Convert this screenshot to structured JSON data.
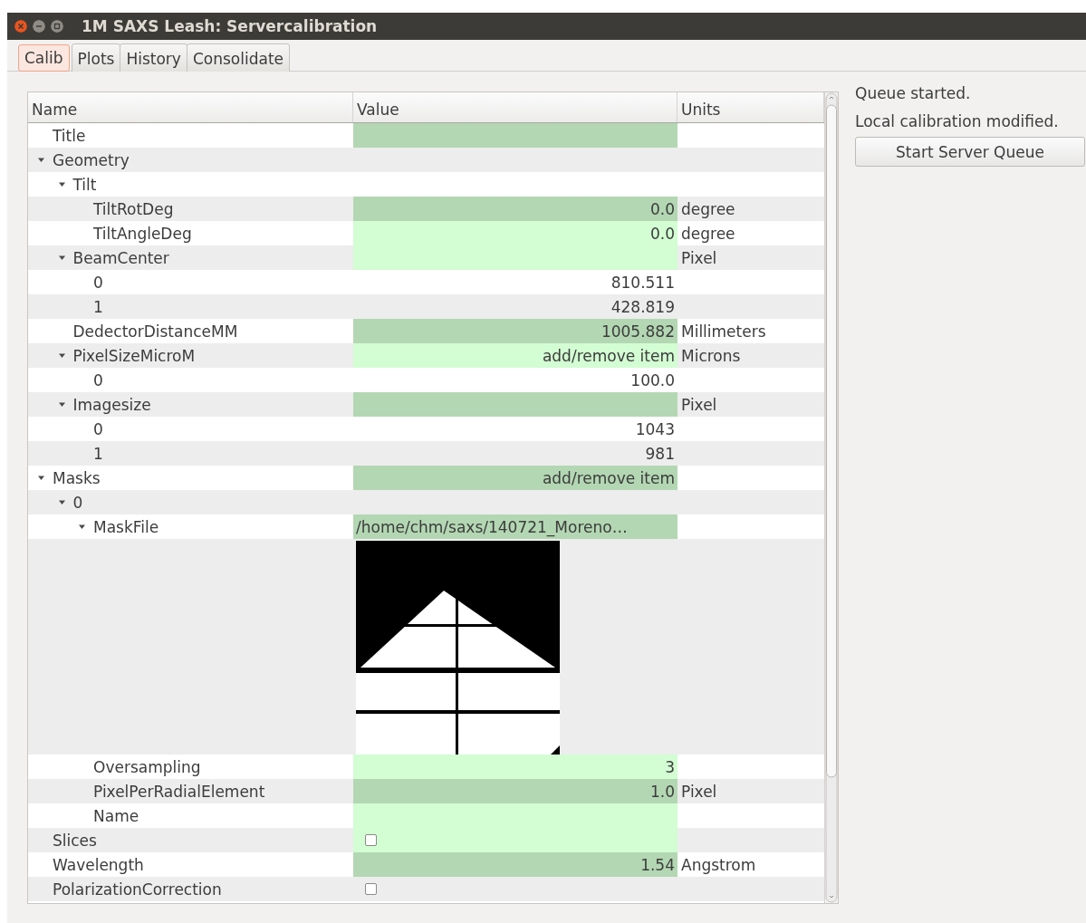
{
  "window": {
    "title": "1M SAXS Leash: Servercalibration"
  },
  "tabs": [
    {
      "label": "Calib",
      "selected": true
    },
    {
      "label": "Plots",
      "selected": false
    },
    {
      "label": "History",
      "selected": false
    },
    {
      "label": "Consolidate",
      "selected": false
    }
  ],
  "tree": {
    "columns": [
      "Name",
      "Value",
      "Units"
    ],
    "rows": [
      {
        "name": "Title",
        "editable": true,
        "highlighted": true
      },
      {
        "name": "Geometry",
        "expanded": true,
        "children": [
          {
            "name": "Tilt",
            "expanded": true,
            "children": [
              {
                "name": "TiltRotDeg",
                "kind": "value",
                "value": "0.0",
                "units": "degree",
                "editable": true,
                "highlighted": true
              },
              {
                "name": "TiltAngleDeg",
                "kind": "value",
                "value": "0.0",
                "units": "degree",
                "editable": true,
                "highlighted": false
              }
            ]
          },
          {
            "name": "BeamCenter",
            "expanded": true,
            "units": "Pixel",
            "editable": true,
            "highlighted": false,
            "children": [
              {
                "name": "0",
                "kind": "value",
                "value": "810.511"
              },
              {
                "name": "1",
                "kind": "value",
                "value": "428.819"
              }
            ]
          },
          {
            "name": "DedectorDistanceMM",
            "kind": "value",
            "value": "1005.882",
            "units": "Millimeters",
            "editable": true,
            "highlighted": true
          },
          {
            "name": "PixelSizeMicroM",
            "expanded": true,
            "kind": "value",
            "value": "add/remove item",
            "units": "Microns",
            "editable": true,
            "highlighted": false,
            "children": [
              {
                "name": "0",
                "kind": "value",
                "value": "100.0"
              }
            ]
          },
          {
            "name": "Imagesize",
            "expanded": true,
            "units": "Pixel",
            "editable": true,
            "highlighted": true,
            "children": [
              {
                "name": "0",
                "kind": "value",
                "value": "1043"
              },
              {
                "name": "1",
                "kind": "value",
                "value": "981"
              }
            ]
          }
        ]
      },
      {
        "name": "Masks",
        "expanded": true,
        "kind": "value",
        "value": "add/remove item",
        "editable": true,
        "highlighted": true,
        "children": [
          {
            "name": "0",
            "expanded": true,
            "children": [
              {
                "name": "MaskFile",
                "expanded": true,
                "kind": "path",
                "value": "/home/chm/saxs/140721_Moreno…",
                "editable": true,
                "highlighted": true
              },
              {
                "name": "Oversampling",
                "kind": "value",
                "value": "3",
                "editable": true,
                "highlighted": false
              },
              {
                "name": "PixelPerRadialElement",
                "kind": "value",
                "value": "1.0",
                "units": "Pixel",
                "editable": true,
                "highlighted": true
              },
              {
                "name": "Name",
                "editable": true,
                "highlighted": false
              }
            ]
          }
        ]
      },
      {
        "name": "Slices",
        "kind": "check",
        "checked": false,
        "editable": true,
        "highlighted": false
      },
      {
        "name": "Wavelength",
        "kind": "value",
        "value": "1.54",
        "units": "Angstrom",
        "editable": true,
        "highlighted": true
      },
      {
        "name": "PolarizationCorrection",
        "kind": "check",
        "checked": false,
        "editable": false
      }
    ]
  },
  "side": {
    "messages": [
      "Queue started.",
      "Local calibration modified."
    ],
    "button": "Start Server Queue"
  }
}
